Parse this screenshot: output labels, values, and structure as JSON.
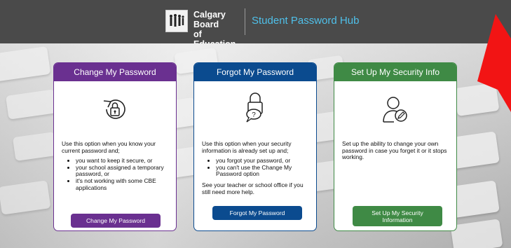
{
  "header": {
    "org_name_line1": "Calgary Board",
    "org_name_line2": "of Education",
    "hub_title": "Student Password Hub"
  },
  "cards": [
    {
      "title": "Change My Password",
      "icon": "refresh-lock-icon",
      "intro": "Use this option when you know your current password and;",
      "bullets": [
        "you want to keep it secure, or",
        "your school assigned a temporary password, or",
        "it's not working with some CBE applications"
      ],
      "footer_text": "",
      "button": "Change My Password",
      "color": "#6a3090"
    },
    {
      "title": "Forgot My Password",
      "icon": "lock-question-icon",
      "intro": "Use this option when your security information is already set up and;",
      "bullets": [
        "you forgot your password, or",
        "you can't use the Change My Password option"
      ],
      "footer_text": "See your teacher or school office if you still need more help.",
      "button": "Forgot My Password",
      "color": "#0b4b8f"
    },
    {
      "title": "Set Up My Security Info",
      "icon": "user-edit-icon",
      "intro": "Set up the ability to change your own password in case you forget it or it stops working.",
      "bullets": [],
      "footer_text": "",
      "button": "Set Up My Security Information",
      "color": "#3f8a45"
    }
  ],
  "colors": {
    "header_bg": "#4a4a4a",
    "hub_title": "#4fc0ea",
    "annotation_arrow": "#f21414"
  }
}
